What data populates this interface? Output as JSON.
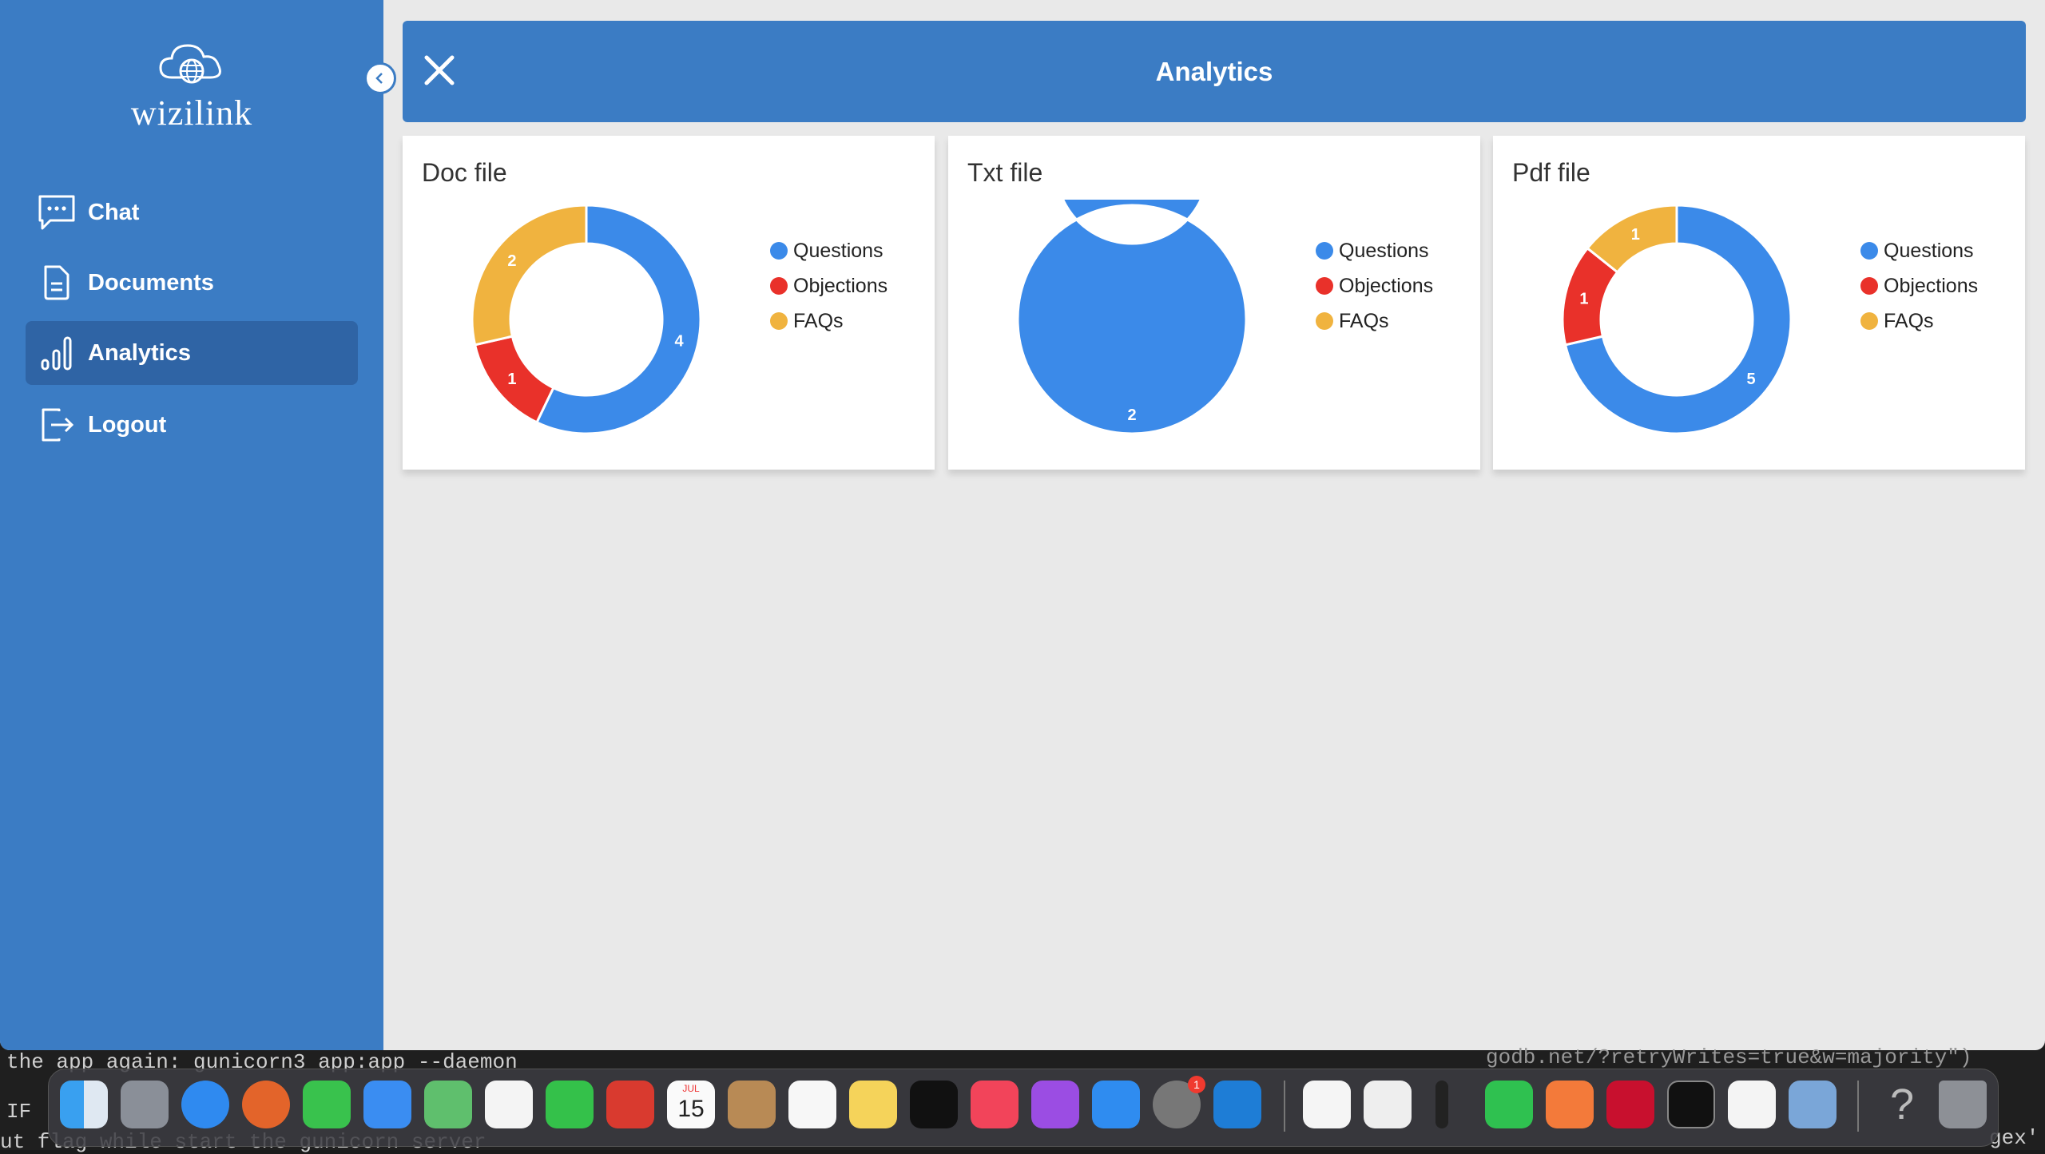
{
  "app": {
    "brand": "wizilink",
    "nav": [
      {
        "label": "Chat",
        "icon": "chat-icon"
      },
      {
        "label": "Documents",
        "icon": "document-icon"
      },
      {
        "label": "Analytics",
        "icon": "bar-chart-icon",
        "active": true
      },
      {
        "label": "Logout",
        "icon": "logout-icon"
      }
    ],
    "header": {
      "title": "Analytics"
    }
  },
  "colors": {
    "sidebar": "#3b7cc4",
    "questions": "#3b8ae9",
    "objections": "#e9312a",
    "faqs": "#f0b33f"
  },
  "chart_data": [
    {
      "type": "pie",
      "title": "Doc file",
      "categories": [
        "Questions",
        "Objections",
        "FAQs"
      ],
      "values": [
        4,
        1,
        2
      ]
    },
    {
      "type": "pie",
      "title": "Txt file",
      "categories": [
        "Questions",
        "Objections",
        "FAQs"
      ],
      "values": [
        2,
        0,
        0
      ]
    },
    {
      "type": "pie",
      "title": "Pdf file",
      "categories": [
        "Questions",
        "Objections",
        "FAQs"
      ],
      "values": [
        5,
        1,
        1
      ]
    }
  ],
  "terminal": {
    "line1": "the app again: gunicorn3 app:app --daemon",
    "line2": "IF",
    "line3": "ut flag while start the gunicorn server",
    "line4": "godb.net/?retryWrites=true&w=majority\")",
    "line5": "gex'"
  },
  "dock": {
    "badge": "1",
    "calendar_month": "JUL",
    "calendar_day": "15"
  }
}
